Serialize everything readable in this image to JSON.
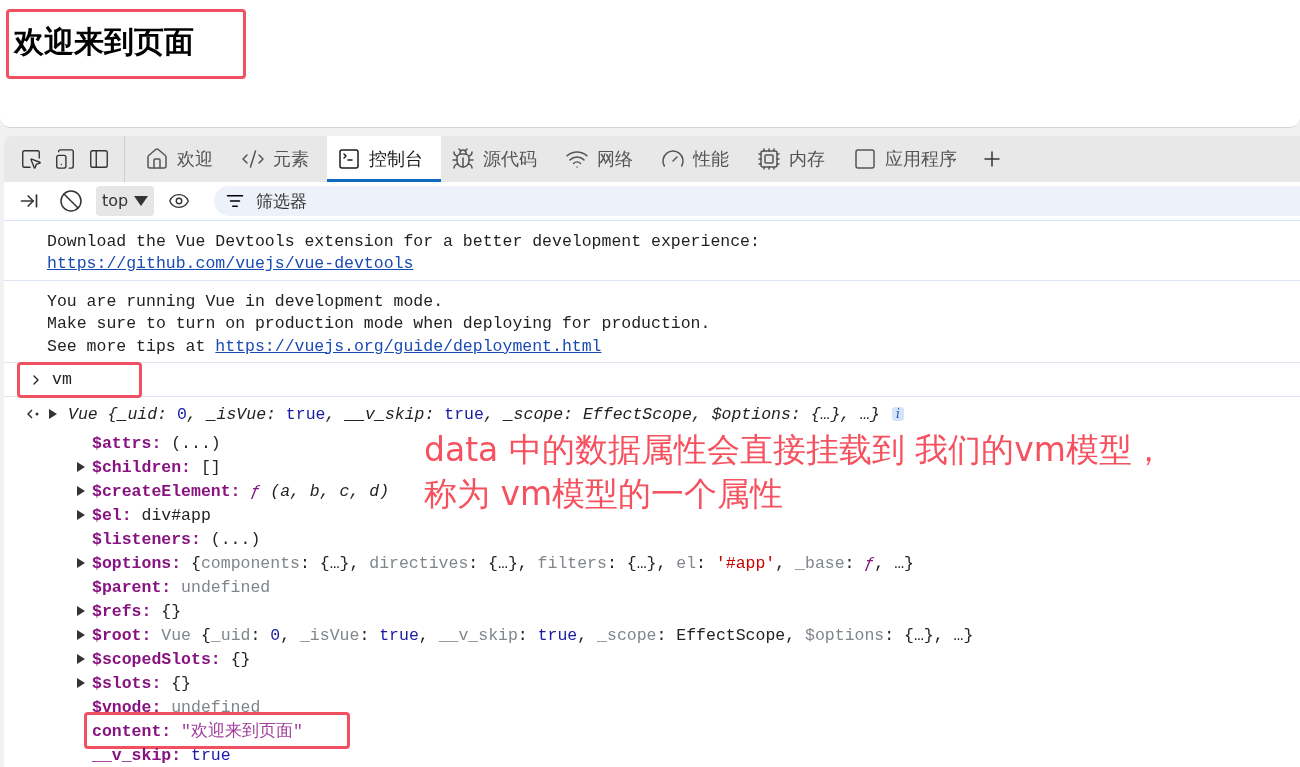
{
  "page": {
    "heading": "欢迎来到页面",
    "highlighted": true
  },
  "devtools": {
    "tabs": [
      {
        "label": "欢迎",
        "selected": false
      },
      {
        "label": "元素",
        "selected": false
      },
      {
        "label": "控制台",
        "selected": true
      },
      {
        "label": "源代码",
        "selected": false
      },
      {
        "label": "网络",
        "selected": false
      },
      {
        "label": "性能",
        "selected": false
      },
      {
        "label": "内存",
        "selected": false
      },
      {
        "label": "应用程序",
        "selected": false
      }
    ],
    "context": "top",
    "filter": {
      "placeholder": "筛选器"
    }
  },
  "messages": [
    {
      "lines": [
        {
          "kind": "text",
          "text": "Download the Vue Devtools extension for a better development experience:"
        },
        {
          "kind": "link",
          "text": "https://github.com/vuejs/vue-devtools"
        }
      ]
    },
    {
      "lines": [
        {
          "kind": "text",
          "text": "You are running Vue in development mode."
        },
        {
          "kind": "text",
          "text": "Make sure to turn on production mode when deploying for production."
        },
        {
          "kind": "mixed",
          "text": "See more tips at ",
          "link": "https://vuejs.org/guide/deployment.html"
        }
      ]
    }
  ],
  "input": {
    "command": "vm",
    "highlighted": true
  },
  "result": {
    "tokens": [
      {
        "kind": "italic",
        "text": "Vue {_uid: "
      },
      {
        "kind": "num",
        "text": "0"
      },
      {
        "kind": "italic",
        "text": ", _isVue: "
      },
      {
        "kind": "num",
        "text": "true"
      },
      {
        "kind": "italic",
        "text": ", __v_skip: "
      },
      {
        "kind": "num",
        "text": "true"
      },
      {
        "kind": "italic",
        "text": ", _scope: EffectScope, $options: {…}, …}"
      }
    ],
    "badge": "i"
  },
  "properties": [
    {
      "key": "$attrs:",
      "expandable": false,
      "highlighted": false,
      "value": [
        {
          "kind": "plain",
          "text": "(...)"
        }
      ]
    },
    {
      "key": "$children:",
      "expandable": true,
      "highlighted": false,
      "value": [
        {
          "kind": "plain",
          "text": "[]"
        }
      ]
    },
    {
      "key": "$createElement:",
      "expandable": true,
      "highlighted": false,
      "value": [
        {
          "kind": "func",
          "text": "ƒ"
        },
        {
          "kind": "italic",
          "text": " (a, b, c, d)"
        }
      ]
    },
    {
      "key": "$el:",
      "expandable": true,
      "highlighted": false,
      "value": [
        {
          "kind": "tag",
          "text": "div#app"
        }
      ]
    },
    {
      "key": "$listeners:",
      "expandable": false,
      "highlighted": false,
      "value": [
        {
          "kind": "plain",
          "text": "(...)"
        }
      ]
    },
    {
      "key": "$options:",
      "expandable": true,
      "highlighted": false,
      "value": [
        {
          "kind": "plain",
          "text": "{"
        },
        {
          "kind": "dim",
          "text": "components"
        },
        {
          "kind": "plain",
          "text": ": {…}, "
        },
        {
          "kind": "dim",
          "text": "directives"
        },
        {
          "kind": "plain",
          "text": ": {…}, "
        },
        {
          "kind": "dim",
          "text": "filters"
        },
        {
          "kind": "plain",
          "text": ": {…}, "
        },
        {
          "kind": "dim",
          "text": "el"
        },
        {
          "kind": "plain",
          "text": ": "
        },
        {
          "kind": "str",
          "text": "'#app'"
        },
        {
          "kind": "plain",
          "text": ", "
        },
        {
          "kind": "dim",
          "text": "_base"
        },
        {
          "kind": "plain",
          "text": ": "
        },
        {
          "kind": "func",
          "text": "ƒ"
        },
        {
          "kind": "plain",
          "text": ", …}"
        }
      ]
    },
    {
      "key": "$parent:",
      "expandable": false,
      "highlighted": false,
      "value": [
        {
          "kind": "dim",
          "text": "undefined"
        }
      ]
    },
    {
      "key": "$refs:",
      "expandable": true,
      "highlighted": false,
      "value": [
        {
          "kind": "plain",
          "text": "{}"
        }
      ]
    },
    {
      "key": "$root:",
      "expandable": true,
      "highlighted": false,
      "value": [
        {
          "kind": "dim",
          "text": "Vue "
        },
        {
          "kind": "plain",
          "text": "{"
        },
        {
          "kind": "dim",
          "text": "_uid"
        },
        {
          "kind": "plain",
          "text": ": "
        },
        {
          "kind": "num",
          "text": "0"
        },
        {
          "kind": "plain",
          "text": ", "
        },
        {
          "kind": "dim",
          "text": "_isVue"
        },
        {
          "kind": "plain",
          "text": ": "
        },
        {
          "kind": "num",
          "text": "true"
        },
        {
          "kind": "plain",
          "text": ", "
        },
        {
          "kind": "dim",
          "text": "__v_skip"
        },
        {
          "kind": "plain",
          "text": ": "
        },
        {
          "kind": "num",
          "text": "true"
        },
        {
          "kind": "plain",
          "text": ", "
        },
        {
          "kind": "dim",
          "text": "_scope"
        },
        {
          "kind": "plain",
          "text": ": EffectScope, "
        },
        {
          "kind": "dim",
          "text": "$options"
        },
        {
          "kind": "plain",
          "text": ": {…}, …}"
        }
      ]
    },
    {
      "key": "$scopedSlots:",
      "expandable": true,
      "highlighted": false,
      "value": [
        {
          "kind": "plain",
          "text": "{}"
        }
      ]
    },
    {
      "key": "$slots:",
      "expandable": true,
      "highlighted": false,
      "value": [
        {
          "kind": "plain",
          "text": "{}"
        }
      ]
    },
    {
      "key": "$vnode:",
      "expandable": false,
      "highlighted": false,
      "value": [
        {
          "kind": "dim",
          "text": "undefined"
        }
      ]
    },
    {
      "key": "content:",
      "expandable": false,
      "highlighted": true,
      "value": [
        {
          "kind": "cstr",
          "text": "\"欢迎来到页面\""
        }
      ]
    },
    {
      "key": "__v_skip:",
      "expandable": false,
      "highlighted": false,
      "value": [
        {
          "kind": "num",
          "text": "true"
        }
      ]
    }
  ],
  "annotation": {
    "lines": [
      "data 中的数据属性会直接挂载到 我们的vm模型，",
      "称为 vm模型的一个属性"
    ]
  }
}
